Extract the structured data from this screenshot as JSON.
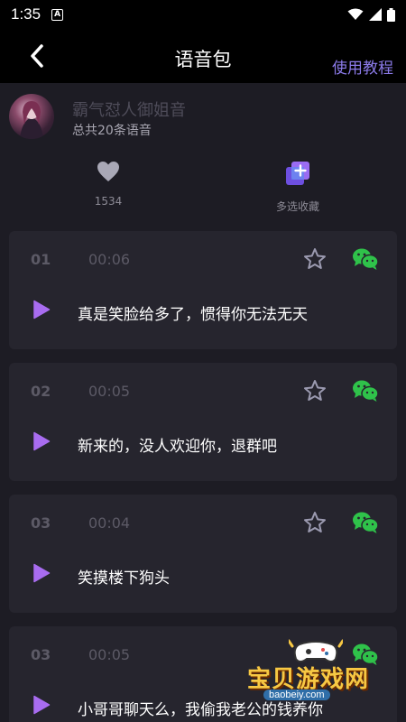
{
  "status": {
    "time": "1:35",
    "badge": "A"
  },
  "nav": {
    "title": "语音包",
    "tutorial": "使用教程"
  },
  "profile": {
    "name": "霸气怼人御姐音",
    "count": "总共20条语音"
  },
  "stats": {
    "likes": "1534",
    "collect": "多选收藏"
  },
  "cards": [
    {
      "num": "01",
      "duration": "00:06",
      "text": "真是笑脸给多了，惯得你无法无天"
    },
    {
      "num": "02",
      "duration": "00:05",
      "text": "新来的，没人欢迎你，退群吧"
    },
    {
      "num": "03",
      "duration": "00:04",
      "text": "笑摸楼下狗头"
    },
    {
      "num": "03",
      "duration": "00:05",
      "text": "小哥哥聊天么，我偷我老公的钱养你"
    }
  ],
  "watermark": {
    "text": "宝贝游戏网",
    "url": "baobeiy.com"
  },
  "colors": {
    "accent": "#8c7bea",
    "play": "#a86cf0",
    "wechat": "#2fc24a",
    "card": "#26252e",
    "background": "#1d1c24"
  }
}
